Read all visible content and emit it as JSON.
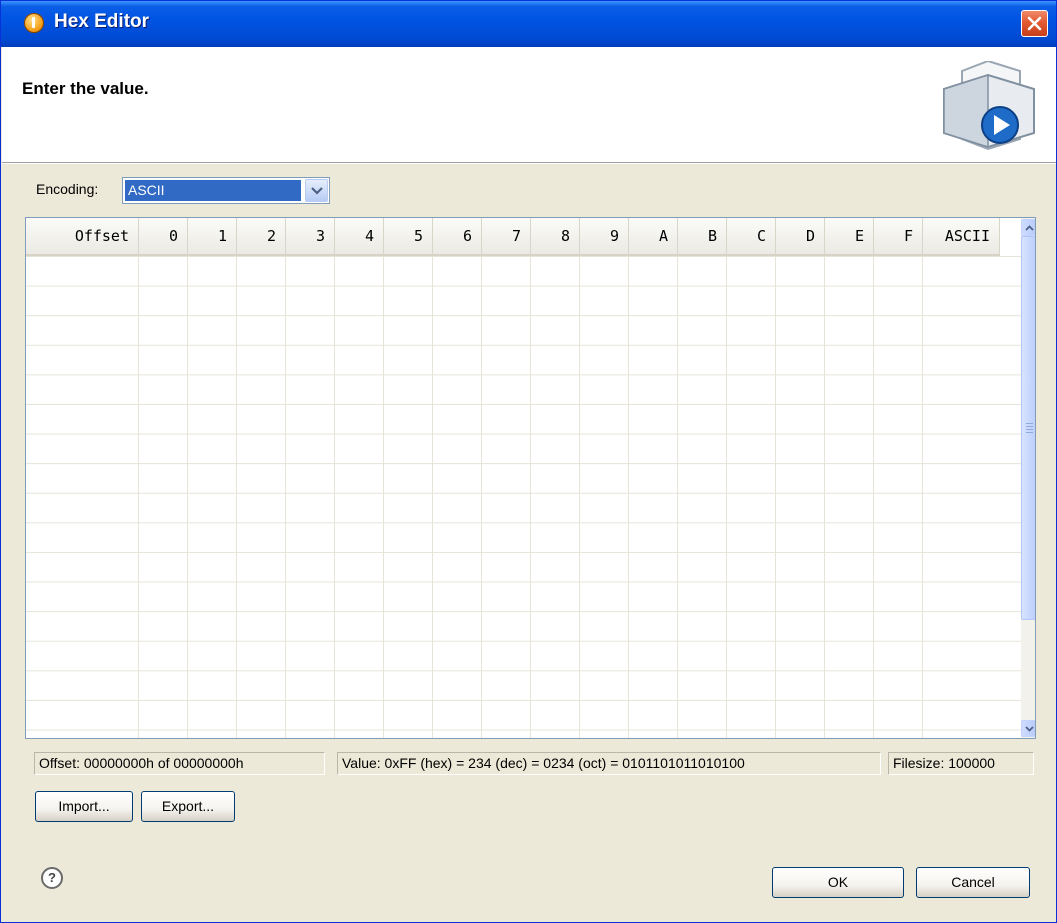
{
  "window": {
    "title": "Hex Editor"
  },
  "banner": {
    "message": "Enter the value."
  },
  "encoding": {
    "label": "Encoding:",
    "value": "ASCII"
  },
  "grid": {
    "columns": [
      "Offset",
      "0",
      "1",
      "2",
      "3",
      "4",
      "5",
      "6",
      "7",
      "8",
      "9",
      "A",
      "B",
      "C",
      "D",
      "E",
      "F",
      "ASCII"
    ],
    "rows": []
  },
  "status": {
    "offset": "Offset: 00000000h of 00000000h",
    "value": "Value: 0xFF (hex) = 234 (dec) = 0234 (oct) = 0101101011010100",
    "filesize": "Filesize: 100000"
  },
  "buttons": {
    "import": "Import...",
    "export": "Export...",
    "ok": "OK",
    "cancel": "Cancel"
  },
  "icons": {
    "title": "app-icon",
    "close": "close-icon",
    "banner": "wizard-banner-graphic",
    "help": "help-icon",
    "dropdown": "chevron-down-icon"
  },
  "colors": {
    "titlebar": "#0054e3",
    "selection": "#316ac5",
    "close": "#e25a32"
  }
}
